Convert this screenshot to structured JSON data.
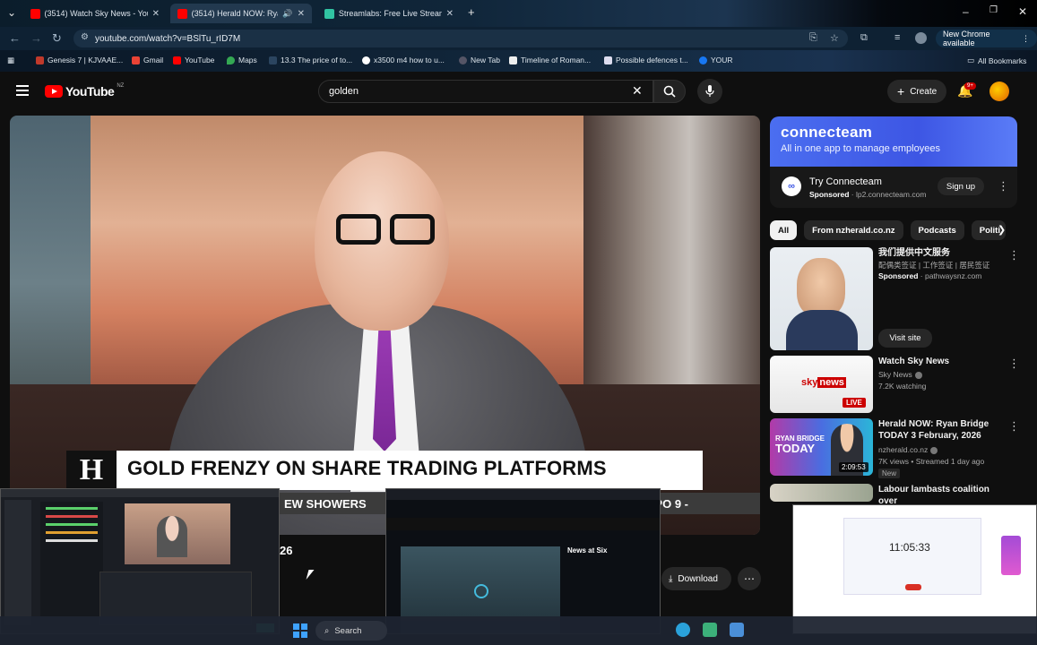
{
  "browser": {
    "tabs": [
      {
        "title": "(3514) Watch Sky News - YouTu"
      },
      {
        "title": "(3514) Herald NOW: Ryan B"
      },
      {
        "title": "Streamlabs: Free Live Streaming"
      }
    ],
    "url": "youtube.com/watch?v=BSlTu_rID7M",
    "new_chrome": "New Chrome available",
    "bookmarks": [
      "Genesis 7 | KJVAAE...",
      "Gmail",
      "YouTube",
      "Maps",
      "13.3 The price of to...",
      "x3500 m4 how to u...",
      "New Tab",
      "Timeline of Roman...",
      "Possible defences t...",
      "YOUR"
    ],
    "all_bookmarks": "All Bookmarks"
  },
  "youtube": {
    "logo": "YouTube",
    "country": "NZ",
    "search_query": "golden",
    "create_label": "Create",
    "notifications": "9+"
  },
  "video": {
    "lower_third": "GOLD FRENZY ON SHARE TRADING PLATFORMS",
    "ticker": "EW SHOWERS",
    "ticker_right": "IPO 9 -",
    "logo_letter": "H",
    "below_number": "26",
    "download_label": "Download"
  },
  "ad": {
    "brand": "connecteam",
    "tagline": "All in one app to manage employees",
    "title": "Try Connecteam",
    "sponsored": "Sponsored",
    "domain": "lp2.connecteam.com",
    "signup": "Sign up"
  },
  "chips": [
    "All",
    "From nzherald.co.nz",
    "Podcasts",
    "Politi"
  ],
  "recommendations": [
    {
      "title": "我们提供中文服务",
      "line2": "配偶类签证 | 工作签证 | 居民签证",
      "channel": "pathwaysnz.com",
      "sponsored": "Sponsored",
      "action": "Visit site"
    },
    {
      "title": "Watch Sky News",
      "channel": "Sky News",
      "meta": "7.2K watching",
      "badge": "LIVE"
    },
    {
      "title": "Herald NOW: Ryan Bridge TODAY 3 February, 2026",
      "channel": "nzherald.co.nz",
      "meta": "7K views • Streamed 1 day ago",
      "badge": "New",
      "duration": "2:09:53"
    },
    {
      "title": "Labour lambasts coalition over"
    }
  ],
  "thumbnails": {
    "clock": "11:05:33",
    "news_title": "News at Six"
  },
  "taskbar": {
    "search": "Search"
  },
  "colors": {
    "youtube_red": "#ff0000",
    "connecteam_blue": "#3d56e4",
    "tie_purple": "#8a2fa6"
  }
}
